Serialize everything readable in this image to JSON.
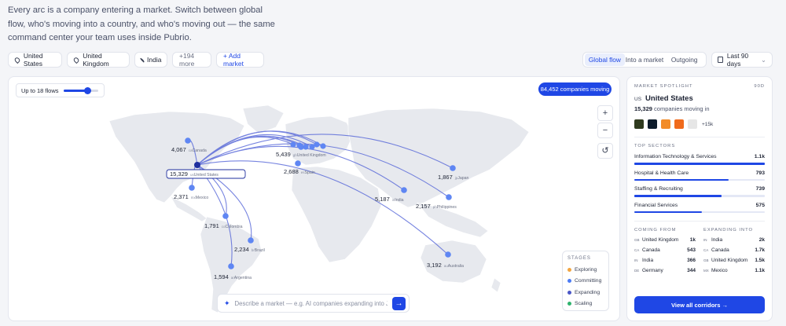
{
  "intro": "Every arc is a company entering a market. Switch between global flow, who's moving into a country, and who's moving out — the same command center your team uses inside Pubrio.",
  "filters": {
    "chips": [
      "United States",
      "United Kingdom",
      "India"
    ],
    "more": "+194 more",
    "add": "+ Add market"
  },
  "view_toggle": {
    "options": [
      "Global flow",
      "Into a market",
      "Outgoing"
    ],
    "active": "Global flow"
  },
  "date_range": "Last 90 days",
  "map": {
    "slider_label": "Up to 18 flows",
    "slider_fraction": 0.7,
    "moving_badge": "84,452 companies moving",
    "zoom_in": "+",
    "zoom_out": "−",
    "reset": "↺",
    "markers": [
      {
        "value": "4,067",
        "cc": "ca",
        "name": "Canada"
      },
      {
        "value": "15,329",
        "cc": "us",
        "name": "United States"
      },
      {
        "value": "2,371",
        "cc": "mx",
        "name": "Mexico"
      },
      {
        "value": "1,791",
        "cc": "co",
        "name": "Colombia"
      },
      {
        "value": "2,234",
        "cc": "br",
        "name": "Brazil"
      },
      {
        "value": "1,594",
        "cc": "ar",
        "name": "Argentina"
      },
      {
        "value": "5,439",
        "cc": "gb",
        "name": "United Kingdom"
      },
      {
        "value": "2,688",
        "cc": "es",
        "name": "Spain"
      },
      {
        "value": "5,187",
        "cc": "in",
        "name": "India"
      },
      {
        "value": "2,157",
        "cc": "ph",
        "name": "Philippines"
      },
      {
        "value": "1,867",
        "cc": "jp",
        "name": "Japan"
      },
      {
        "value": "3,192",
        "cc": "au",
        "name": "Australia"
      }
    ],
    "stages": {
      "title": "STAGES",
      "items": [
        {
          "label": "Exploring",
          "color": "#f2a541"
        },
        {
          "label": "Committing",
          "color": "#4b7bf5"
        },
        {
          "label": "Expanding",
          "color": "#4a56c7"
        },
        {
          "label": "Scaling",
          "color": "#2fb36e"
        }
      ]
    },
    "ask_placeholder": "Describe a market — e.g. AI companies expanding into Japan",
    "ask_button": "→"
  },
  "spotlight": {
    "caption": "MARKET SPOTLIGHT",
    "period": "90D",
    "cc": "US",
    "country": "United States",
    "count": "15,329",
    "count_suffix": "companies moving in",
    "logos_more": "+15k",
    "logo_colors": [
      "#2f3a1e",
      "#0d1b2a",
      "#f28c28",
      "#f06a1b",
      "#e6e6e6"
    ],
    "sectors_title": "TOP SECTORS",
    "sectors": [
      {
        "name": "Information Technology & Services",
        "value": "1.1k",
        "fraction": 1.0
      },
      {
        "name": "Hospital & Health Care",
        "value": "793",
        "fraction": 0.72
      },
      {
        "name": "Staffing & Recruiting",
        "value": "739",
        "fraction": 0.67
      },
      {
        "name": "Financial Services",
        "value": "575",
        "fraction": 0.52
      }
    ],
    "coming_from_title": "COMING FROM",
    "coming_from": [
      {
        "cc": "GB",
        "name": "United Kingdom",
        "value": "1k"
      },
      {
        "cc": "CA",
        "name": "Canada",
        "value": "543"
      },
      {
        "cc": "IN",
        "name": "India",
        "value": "366"
      },
      {
        "cc": "DE",
        "name": "Germany",
        "value": "344"
      }
    ],
    "expanding_title": "EXPANDING INTO",
    "expanding_into": [
      {
        "cc": "IN",
        "name": "India",
        "value": "2k"
      },
      {
        "cc": "CA",
        "name": "Canada",
        "value": "1.7k"
      },
      {
        "cc": "GB",
        "name": "United Kingdom",
        "value": "1.5k"
      },
      {
        "cc": "MX",
        "name": "Mexico",
        "value": "1.1k"
      }
    ],
    "cta": "View all corridors →"
  }
}
